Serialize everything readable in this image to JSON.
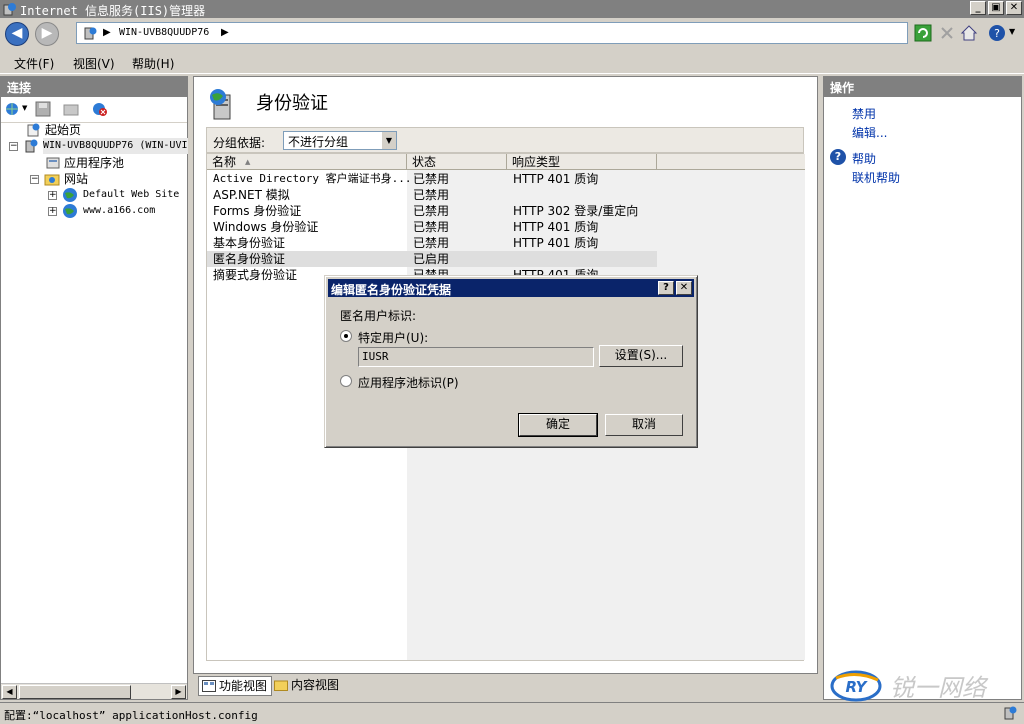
{
  "window": {
    "title": "Internet 信息服务(IIS)管理器"
  },
  "address": {
    "crumbs": [
      "WIN-UVB8QUUDP76"
    ]
  },
  "menu": {
    "file": "文件(F)",
    "view": "视图(V)",
    "help": "帮助(H)"
  },
  "connections": {
    "header": "连接",
    "tree": [
      {
        "label": "起始页",
        "level": 1,
        "icon": "home-page-icon"
      },
      {
        "label": "WIN-UVB8QUUDP76 (WIN-UVI",
        "level": 0,
        "icon": "server-icon",
        "expanded": true
      },
      {
        "label": "应用程序池",
        "level": 2,
        "icon": "app-pool-icon"
      },
      {
        "label": "网站",
        "level": 1,
        "icon": "sites-folder-icon",
        "expanded": true
      },
      {
        "label": "Default Web Site",
        "level": 2,
        "icon": "globe-icon"
      },
      {
        "label": "www.a166.com",
        "level": 2,
        "icon": "globe-icon"
      }
    ]
  },
  "main": {
    "title": "身份验证",
    "group_label": "分组依据:",
    "group_value": "不进行分组",
    "columns": {
      "name": "名称",
      "status": "状态",
      "response": "响应类型"
    },
    "rows": [
      {
        "name": "Active Directory 客户端证书身...",
        "status": "已禁用",
        "response": "HTTP 401 质询"
      },
      {
        "name": "ASP.NET 模拟",
        "status": "已禁用",
        "response": ""
      },
      {
        "name": "Forms 身份验证",
        "status": "已禁用",
        "response": "HTTP 302 登录/重定向"
      },
      {
        "name": "Windows 身份验证",
        "status": "已禁用",
        "response": "HTTP 401 质询"
      },
      {
        "name": "基本身份验证",
        "status": "已禁用",
        "response": "HTTP 401 质询"
      },
      {
        "name": "匿名身份验证",
        "status": "已启用",
        "response": ""
      },
      {
        "name": "摘要式身份验证",
        "status": "已禁用",
        "response": "HTTP 401 质询"
      }
    ]
  },
  "actions": {
    "header": "操作",
    "disable": "禁用",
    "edit": "编辑...",
    "help": "帮助",
    "online_help": "联机帮助"
  },
  "view_tabs": {
    "feature": "功能视图",
    "content": "内容视图"
  },
  "status": {
    "text": "配置:“localhost” applicationHost.config"
  },
  "dialog": {
    "title": "编辑匿名身份验证凭据",
    "group_label": "匿名用户标识:",
    "specific_user": "特定用户(U):",
    "user_value": "IUSR",
    "set_button": "设置(S)...",
    "app_pool_identity": "应用程序池标识(P)",
    "ok": "确定",
    "cancel": "取消",
    "help_glyph": "?",
    "close_glyph": "✕"
  },
  "colors": {
    "selection": "#dedede",
    "link": "#0033aa",
    "dialog_title": "#0a246a"
  }
}
